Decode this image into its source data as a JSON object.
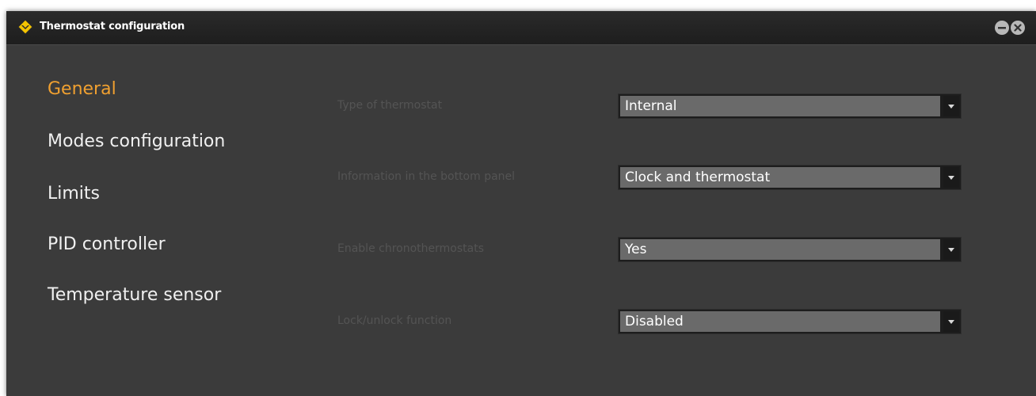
{
  "window": {
    "title": "Thermostat configuration",
    "app_icon": "yellow-diamond-arrow-icon",
    "controls": [
      "minimize-icon",
      "close-icon"
    ]
  },
  "nav": {
    "active_color": "#f0a030",
    "items": [
      {
        "label": "General",
        "active": true
      },
      {
        "label": "Modes configuration",
        "active": false
      },
      {
        "label": "Limits",
        "active": false
      },
      {
        "label": "PID controller",
        "active": false
      },
      {
        "label": "Temperature sensor",
        "active": false
      }
    ]
  },
  "settings": [
    {
      "label": "Type of thermostat",
      "value": "Internal"
    },
    {
      "label": "Information in the bottom panel",
      "value": "Clock and thermostat"
    },
    {
      "label": "Enable chronothermostats",
      "value": "Yes"
    },
    {
      "label": "Lock/unlock function",
      "value": "Disabled"
    }
  ]
}
